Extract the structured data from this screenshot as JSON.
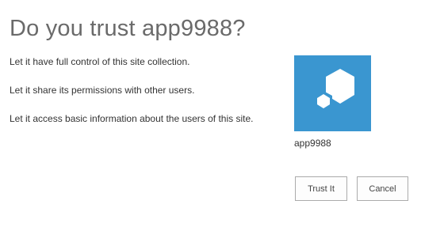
{
  "dialog": {
    "title": "Do you trust app9988?",
    "permissions": [
      "Let it have full control of this site collection.",
      "Let it share its permissions with other users.",
      "Let it access basic information about the users of this site."
    ],
    "app": {
      "name": "app9988",
      "icon": "app-hexagon-icon",
      "tile_color": "#3a96d0"
    },
    "buttons": {
      "trust_label": "Trust It",
      "cancel_label": "Cancel"
    }
  }
}
